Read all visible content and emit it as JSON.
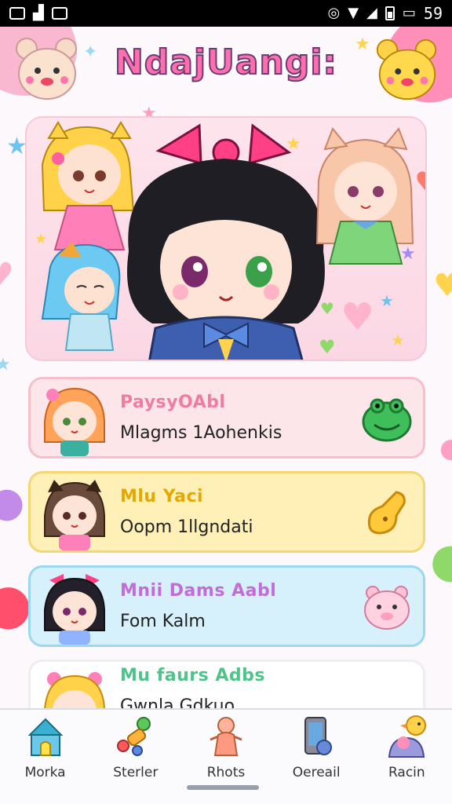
{
  "status_bar": {
    "time": "59"
  },
  "app": {
    "title": "NdajUangi:"
  },
  "cards": [
    {
      "title": "PaysyOAbl",
      "subtitle": "Mlagms 1Aohenkis",
      "title_color": "#f27ba3"
    },
    {
      "title": "Mlu Yaci",
      "subtitle": "Oopm 1llgndati",
      "title_color": "#e5a800"
    },
    {
      "title": "Mnii Dams Aabl",
      "subtitle": "Fom Kalm",
      "title_color": "#c36bd8"
    },
    {
      "title": "Mu faurs Adbs",
      "subtitle": "Gwnla Gdkuo",
      "title_color": "#4fc48a"
    }
  ],
  "tabs": [
    {
      "label": "Morka",
      "icon": "house-icon"
    },
    {
      "label": "Sterler",
      "icon": "toy-icon"
    },
    {
      "label": "Rhots",
      "icon": "figure-icon"
    },
    {
      "label": "Oereail",
      "icon": "phone-icon"
    },
    {
      "label": "Racin",
      "icon": "duck-icon"
    }
  ],
  "colors": {
    "accent_pink": "#ff6fae",
    "card_pink": "#fde6ea",
    "card_yellow": "#fff0b8",
    "card_blue": "#d6f1fb"
  }
}
